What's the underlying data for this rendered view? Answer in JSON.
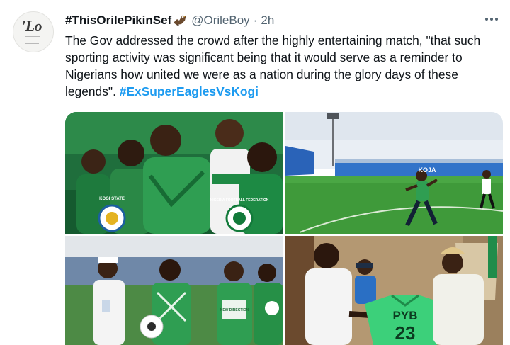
{
  "tweet": {
    "avatar_text": "'Lo",
    "display_name": "#ThisOrilePikinSef",
    "handle": "@OrileBoy",
    "separator": "·",
    "time": "2h",
    "text_before": "The Gov addressed the crowd after the highly entertaining match, \"that such sporting activity was significant being that it would serve as a reminder to Nigerians how united we were as a nation during the glory days of these legends\". ",
    "hashtag": "#ExSuperEaglesVsKogi",
    "icons": {
      "name_badge": "eagle-emoji-icon",
      "more": "more-options-icon"
    },
    "colors": {
      "link": "#1d9bf0",
      "secondary_text": "#536471",
      "primary_text": "#0f1419"
    }
  },
  "media": {
    "photo_1": {
      "badge_text": "KOGI STATE",
      "badge_text_2": "NIGERIA FOOTBALL FEDERATION"
    },
    "photo_2": {
      "stand_text": "KOJA"
    },
    "photo_3": {
      "shirt_text": "NEW DIRECTION"
    },
    "photo_4": {
      "jersey_name": "PYB",
      "jersey_number": "23"
    }
  }
}
